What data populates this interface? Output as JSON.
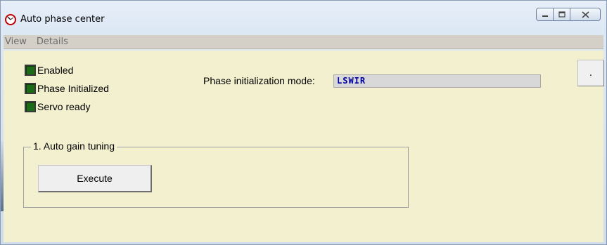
{
  "window": {
    "title": "Auto phase center",
    "icon": "gauge-icon"
  },
  "caption_buttons": {
    "minimize_icon": "minimize-icon",
    "maximize_icon": "maximize-icon",
    "close_icon": "close-icon"
  },
  "menu": {
    "items": [
      {
        "label": "View"
      },
      {
        "label": "Details"
      }
    ]
  },
  "status": {
    "items": [
      {
        "label": "Enabled",
        "led_color": "#1c6b16"
      },
      {
        "label": "Phase Initialized",
        "led_color": "#1c6b16"
      },
      {
        "label": "Servo ready",
        "led_color": "#1c6b16"
      }
    ]
  },
  "phase_mode": {
    "label": "Phase initialization mode:",
    "value": "LSWIR"
  },
  "dot_button": {
    "label": "."
  },
  "auto_gain": {
    "title": "1. Auto gain tuning",
    "execute_label": "Execute"
  },
  "colors": {
    "panel_background": "#f3f0d0",
    "field_text": "#0000a0",
    "led_on": "#1c6b16"
  }
}
